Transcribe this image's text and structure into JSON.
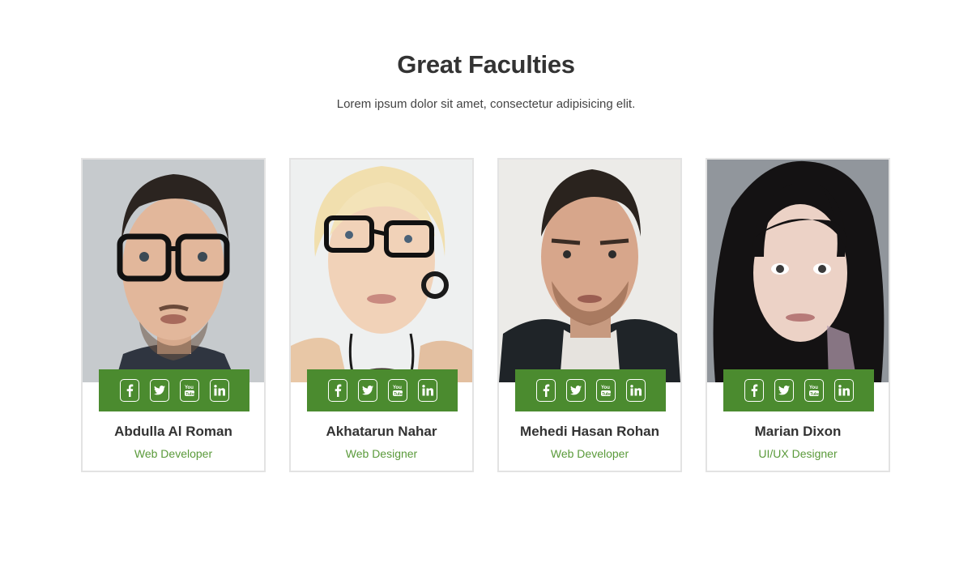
{
  "section": {
    "title": "Great Faculties",
    "subtitle": "Lorem ipsum dolor sit amet, consectetur adipisicing elit."
  },
  "colors": {
    "accent": "#4b8b2f",
    "role_text": "#5a9a3a",
    "heading": "#333333",
    "card_border": "#e3e3e3"
  },
  "social_icons": [
    "facebook-icon",
    "twitter-icon",
    "youtube-icon",
    "linkedin-icon"
  ],
  "faculty": [
    {
      "name": "Abdulla Al Roman",
      "role": "Web Developer"
    },
    {
      "name": "Akhatarun Nahar",
      "role": "Web Designer"
    },
    {
      "name": "Mehedi Hasan Rohan",
      "role": "Web Developer"
    },
    {
      "name": "Marian Dixon",
      "role": "UI/UX Designer"
    }
  ]
}
